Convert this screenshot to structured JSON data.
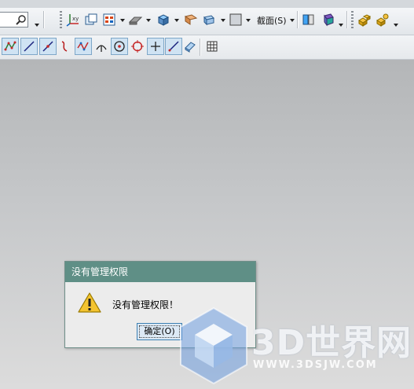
{
  "toolbar": {
    "section_menu_label": "截面(S)",
    "icons": [
      "search-icon",
      "coordinate-system-icon",
      "copy-icon",
      "grid-select-icon",
      "sheet-metal-icon",
      "block-icon",
      "fold-icon",
      "extrude-icon",
      "box-style-icon",
      "display-icon",
      "assembly-icon",
      "constraints-icon"
    ]
  },
  "sketch_toolbar": {
    "icons": [
      "profile-icon",
      "line-icon",
      "arc-line-icon",
      "spline-icon",
      "polyline-icon",
      "fillet-icon",
      "circle-icon",
      "point-circle-icon",
      "cross-icon",
      "pencil-icon",
      "eraser-icon",
      "table-icon"
    ]
  },
  "dialog": {
    "title": "没有管理权限",
    "message": "没有管理权限！",
    "ok_label": "确定(O)"
  },
  "watermark": {
    "text": "3D世界网",
    "url": "WWW.3DSJW.COM"
  },
  "colors": {
    "dialog_titlebar": "#5f8f86",
    "workspace_top": "#b4b6b8",
    "workspace_bottom": "#dcdcdc",
    "watermark_blue": "#6f9fe0"
  }
}
